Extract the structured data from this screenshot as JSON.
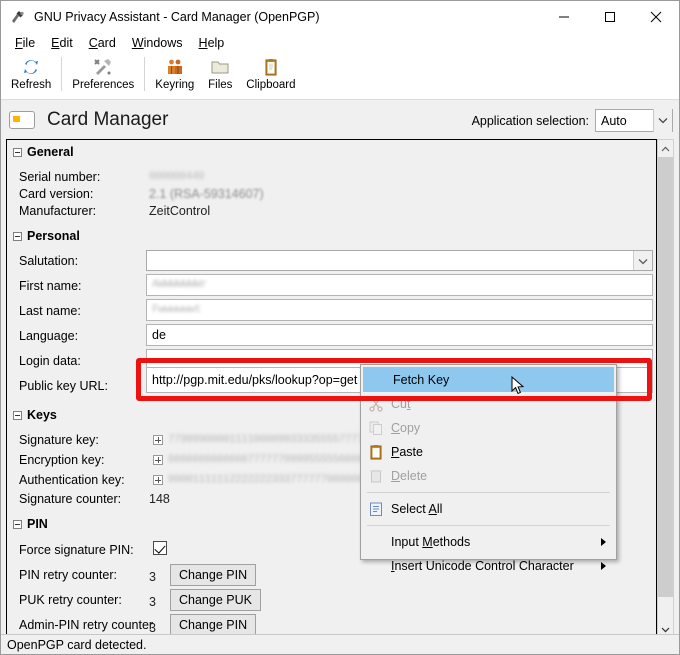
{
  "window": {
    "title": "GNU Privacy Assistant - Card Manager (OpenPGP)",
    "app_icon": "gpa-icon",
    "controls": {
      "minimize": "–",
      "maximize": "☐",
      "close": "✕"
    }
  },
  "menubar": {
    "items": [
      {
        "label": "File",
        "mnemonic": "F"
      },
      {
        "label": "Edit",
        "mnemonic": "E"
      },
      {
        "label": "Card",
        "mnemonic": "C"
      },
      {
        "label": "Windows",
        "mnemonic": "W"
      },
      {
        "label": "Help",
        "mnemonic": "H"
      }
    ]
  },
  "toolbar": {
    "buttons": [
      {
        "label": "Refresh",
        "icon": "refresh-icon"
      },
      {
        "label": "Preferences",
        "icon": "preferences-icon"
      },
      {
        "label": "Keyring",
        "icon": "keyring-icon"
      },
      {
        "label": "Files",
        "icon": "files-icon"
      },
      {
        "label": "Clipboard",
        "icon": "clipboard-icon"
      }
    ]
  },
  "page_header": {
    "icon": "smartcard-icon",
    "title": "Card Manager",
    "app_selection_label": "Application selection:",
    "app_selection_value": "Auto"
  },
  "general": {
    "section_title": "General",
    "rows": [
      {
        "label": "Serial number:",
        "value": "000000449",
        "redacted": true
      },
      {
        "label": "Card version:",
        "value": "2.1 (RSA-59314607)",
        "redacted": false
      },
      {
        "label": "Manufacturer:",
        "value": "ZeitControl",
        "redacted": false
      }
    ]
  },
  "personal": {
    "section_title": "Personal",
    "salutation_label": "Salutation:",
    "salutation_value": "",
    "first_name_label": "First name:",
    "first_name_value": "AWWWWWWWr",
    "last_name_label": "Last name:",
    "last_name_value": "Fwwwwwwt",
    "language_label": "Language:",
    "language_value": "de",
    "login_data_label": "Login data:",
    "login_data_value": "",
    "public_key_url_label": "Public key URL:",
    "public_key_url_value": "http://pgp.mit.edu/pks/lookup?op=get"
  },
  "keys": {
    "section_title": "Keys",
    "rows": [
      {
        "label": "Signature key:",
        "value": "7799990000111100009933335555777711385",
        "expandable": true
      },
      {
        "label": "Encryption key:",
        "value": "6666666666666777777099955555666666FF1",
        "expandable": true
      },
      {
        "label": "Authentication key:",
        "value": "0000111111222222233377777700000055FF2",
        "expandable": true
      }
    ],
    "signature_counter_label": "Signature counter:",
    "signature_counter_value": "148"
  },
  "pin": {
    "section_title": "PIN",
    "force_signature_pin_label": "Force signature PIN:",
    "force_signature_pin_checked": true,
    "rows": [
      {
        "label": "PIN retry counter:",
        "value": "3",
        "button": "Change PIN"
      },
      {
        "label": "PUK retry counter:",
        "value": "3",
        "button": "Change PUK"
      },
      {
        "label": "Admin-PIN retry counter",
        "value": "3",
        "button": "Change PIN"
      }
    ]
  },
  "context_menu": {
    "items": [
      {
        "label": "Fetch Key",
        "icon": null,
        "state": "highlighted",
        "submenu": false
      },
      {
        "label": "Cut",
        "mnemonic": "t",
        "icon": "cut-icon",
        "state": "disabled",
        "submenu": false
      },
      {
        "label": "Copy",
        "mnemonic": "C",
        "icon": "copy-icon",
        "state": "disabled",
        "submenu": false
      },
      {
        "label": "Paste",
        "mnemonic": "P",
        "icon": "paste-icon",
        "state": "enabled",
        "submenu": false
      },
      {
        "label": "Delete",
        "mnemonic": "D",
        "icon": "delete-icon",
        "state": "disabled",
        "submenu": false
      },
      {
        "label": "Select All",
        "mnemonic": "A",
        "icon": "select-all-icon",
        "state": "enabled",
        "submenu": false
      },
      {
        "label": "Input Methods",
        "mnemonic": "M",
        "icon": null,
        "state": "enabled",
        "submenu": true
      },
      {
        "label": "Insert Unicode Control Character",
        "mnemonic": "I",
        "icon": null,
        "state": "enabled",
        "submenu": true
      }
    ]
  },
  "statusbar": {
    "text": "OpenPGP card detected."
  },
  "colors": {
    "highlight": "#8fc8ee",
    "annotation_red": "#ee1111",
    "window_bg": "#f0f0f0",
    "field_bg": "#ffffff"
  }
}
